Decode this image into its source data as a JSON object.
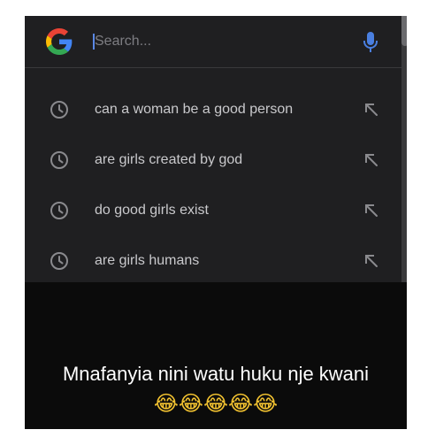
{
  "search": {
    "placeholder": "Search..."
  },
  "suggestions": [
    {
      "text": "can a woman be a good person",
      "icon": "history-clock-icon",
      "action_icon": "fill-query-arrow-icon"
    },
    {
      "text": "are girls created by god",
      "icon": "history-clock-icon",
      "action_icon": "fill-query-arrow-icon"
    },
    {
      "text": "do good girls exist",
      "icon": "history-clock-icon",
      "action_icon": "fill-query-arrow-icon"
    },
    {
      "text": "are girls humans",
      "icon": "history-clock-icon",
      "action_icon": "fill-query-arrow-icon"
    }
  ],
  "caption": {
    "text": "Mnafanyia nini watu huku nje kwani",
    "emojis": "😂😂😂😂😂"
  },
  "colors": {
    "panel": "#1f1f21",
    "background": "#0b0b0b",
    "suggestion_text": "#c9c9cc",
    "icon": "#8a8a8e",
    "mic": "#4a7fe0",
    "google_blue": "#4285f4",
    "google_red": "#ea4335",
    "google_yellow": "#fbbc05",
    "google_green": "#34a853"
  }
}
